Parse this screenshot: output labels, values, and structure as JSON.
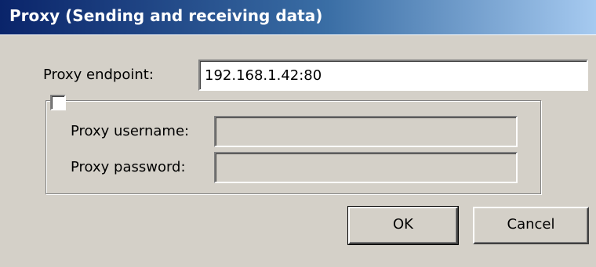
{
  "window": {
    "title": "Proxy (Sending and receiving data)"
  },
  "form": {
    "endpoint_label": "Proxy endpoint:",
    "endpoint_value": "192.168.1.42:80",
    "auth_enabled": false,
    "username_label": "Proxy username:",
    "username_value": "",
    "password_label": "Proxy password:",
    "password_value": ""
  },
  "buttons": {
    "ok_label": "OK",
    "cancel_label": "Cancel"
  },
  "colors": {
    "titlebar_start": "#0a246a",
    "titlebar_end": "#a6caf0",
    "dialog_background": "#d4d0c8"
  }
}
